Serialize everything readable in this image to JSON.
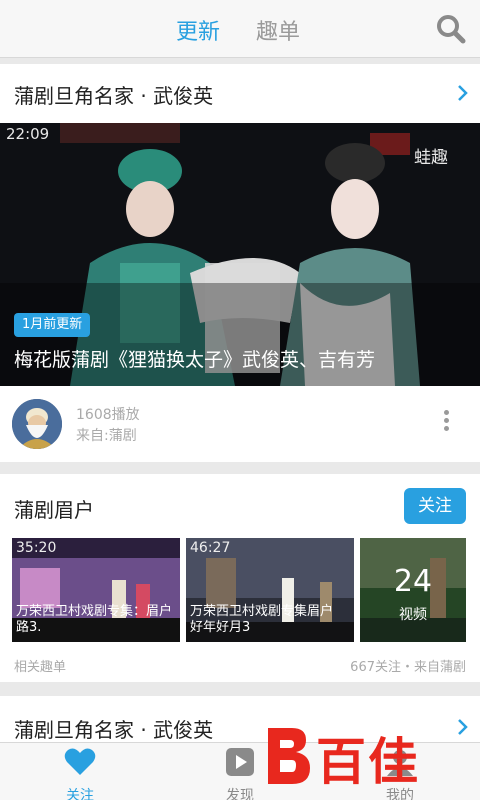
{
  "header": {
    "tabs": [
      {
        "label": "更新",
        "active": true
      },
      {
        "label": "趣单",
        "active": false
      }
    ],
    "search_icon": "search-icon"
  },
  "feed": {
    "card1": {
      "title": "蒲剧旦角名家 · 武俊英",
      "video": {
        "duration": "22:09",
        "watermark": "蛙趣",
        "badge": "1月前更新",
        "title": "梅花版蒲剧《狸猫换太子》武俊英、吉有芳"
      },
      "plays": "1608播放",
      "source": "来自:蒲剧"
    },
    "card2": {
      "title": "蒲剧眉户",
      "follow_label": "关注",
      "videos": [
        {
          "duration": "35:20",
          "caption": "万荣西卫村戏剧专集：眉户 路3."
        },
        {
          "duration": "46:27",
          "caption": "万荣西卫村戏剧专集眉户 好年好月3"
        }
      ],
      "more_count": "24",
      "more_label": "视频",
      "footer_left": "相关趣单",
      "footer_right": "667关注・来自蒲剧"
    },
    "card3": {
      "title": "蒲剧旦角名家 · 武俊英"
    }
  },
  "tabbar": {
    "items": [
      {
        "label": "关注",
        "icon": "heart-icon",
        "active": true
      },
      {
        "label": "发现",
        "icon": "play-icon",
        "active": false
      },
      {
        "label": "我的",
        "icon": "user-icon",
        "active": false
      }
    ]
  },
  "logo": {
    "text": "百佳"
  },
  "colors": {
    "accent": "#29a0e0",
    "logo": "#e8281e"
  }
}
